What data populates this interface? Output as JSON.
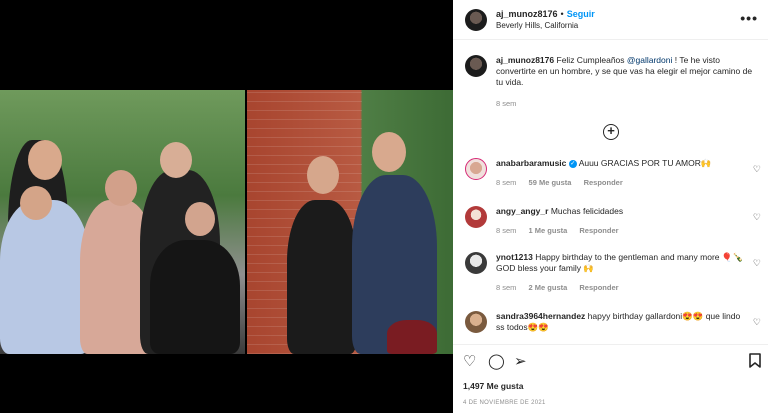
{
  "post": {
    "username": "aj_munoz8176",
    "follow_label": "Seguir",
    "location": "Beverly Hills, California",
    "more_icon": "more-horizontal-icon"
  },
  "caption": {
    "username": "aj_munoz8176",
    "text_before": "Feliz Cumpleaños ",
    "mention": "@gallardoni",
    "text_after": " ! Te he visto convertirte en un hombre, y se que vas ha elegir el mejor camino de tu vida.",
    "time": "8 sem"
  },
  "load_more_icon": "plus-circle-icon",
  "comments": [
    {
      "username": "anabarbaramusic",
      "verified": true,
      "text": "Auuu GRACIAS POR TU AMOR🙌",
      "time": "8 sem",
      "likes": "59 Me gusta",
      "reply": "Responder",
      "avatar_color": "#e8d6d0"
    },
    {
      "username": "angy_angy_r",
      "verified": false,
      "text": "Muchas felicidades",
      "time": "8 sem",
      "likes": "1 Me gusta",
      "reply": "Responder",
      "avatar_color": "#b23a3a"
    },
    {
      "username": "ynot1213",
      "verified": false,
      "text": "Happy birthday to the gentleman and many more 🎈🍾 GOD bless your family 🙌",
      "time": "8 sem",
      "likes": "2 Me gusta",
      "reply": "Responder",
      "avatar_color": "#4a4a4a"
    },
    {
      "username": "sandra3964hernandez",
      "verified": false,
      "text": "hapyy birthday gallardoni😍😍 que lindo ss todos😍😍",
      "time": "",
      "likes": "",
      "reply": "",
      "avatar_color": "#8a6b4e"
    }
  ],
  "actions": {
    "like_icon": "heart-icon",
    "comment_icon": "comment-icon",
    "share_icon": "share-icon",
    "save_icon": "bookmark-icon"
  },
  "likes_count": "1,497 Me gusta",
  "date": "4 DE NOVIEMBRE DE 2021"
}
